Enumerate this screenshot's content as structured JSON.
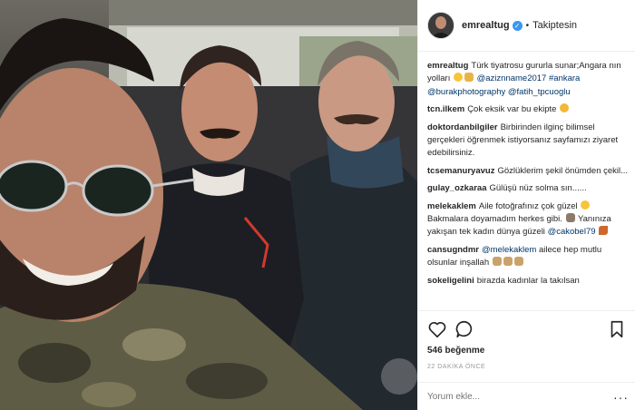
{
  "header": {
    "username": "emrealtug",
    "verified_mark": "✓",
    "separator": "•",
    "follow_status": "Takiptesin"
  },
  "caption": {
    "username": "emrealtug",
    "text_1": "Türk tiyatrosu gururla sunar;Angara nın yolları",
    "mention_1": "@aziznname2017",
    "hashtag_1": "#ankara",
    "mention_2": "@burakphotography",
    "mention_3": "@fatih_tpcuoglu"
  },
  "comments": [
    {
      "username": "tcn.ilkem",
      "text": "Çok eksik var bu ekipte"
    },
    {
      "username": "doktordanbilgiler",
      "text": "Birbirinden ilginç bilimsel gerçekleri öğrenmek istiyorsanız sayfamızı ziyaret edebilirsiniz."
    },
    {
      "username": "tcsemanuryavuz",
      "text": "Gözlüklerim şekil önümden çekil..."
    },
    {
      "username": "gulay_ozkaraa",
      "text": "Gülüşü nüz solma sın......"
    },
    {
      "username": "melekaklem",
      "text_1": "Aile fotoğrafınız çok güzel",
      "text_2": "Bakmalara doyamadım herkes gibi.",
      "text_3": "Yanınıza yakışan tek kadın dünya güzeli",
      "mention": "@cakobel79"
    },
    {
      "username": "cansugndmr",
      "mention": "@melekaklem",
      "text": "ailece hep mutlu olsunlar inşallah"
    },
    {
      "username": "sokeligelini",
      "text": "birazda kadınlar la takılsan"
    }
  ],
  "actions": {
    "like_icon": "heart-icon",
    "comment_icon": "speech-bubble-icon",
    "save_icon": "bookmark-icon",
    "likes_count": "546",
    "likes_label": "beğenme",
    "time_ago": "22 DAKİKA ÖNCE",
    "comment_placeholder": "Yorum ekle...",
    "more_label": "···"
  },
  "colors": {
    "link": "#003569",
    "verified": "#3897f0",
    "border": "#efefef",
    "muted": "#999999"
  }
}
